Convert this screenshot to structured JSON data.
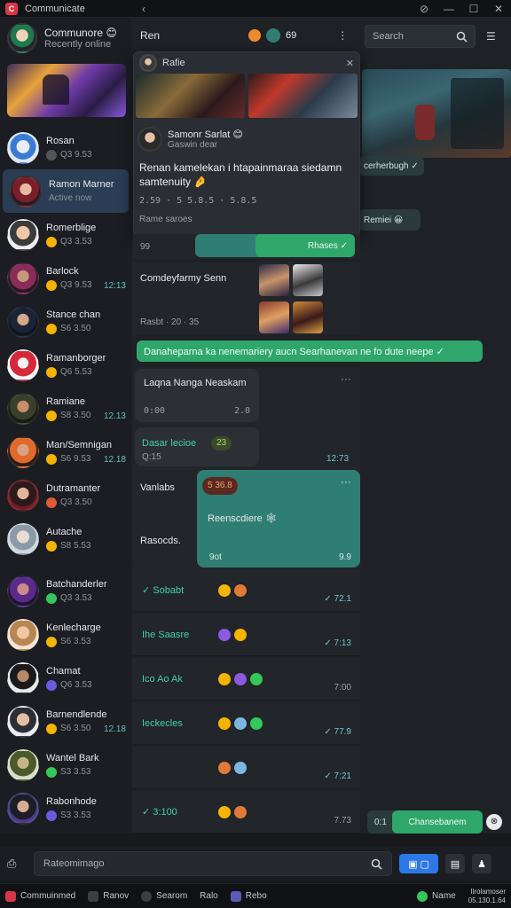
{
  "window": {
    "title": "Communicate",
    "logo": "C",
    "back_glyph": "‹",
    "controls": [
      "minimize",
      "maximize",
      "close"
    ]
  },
  "sidebar": {
    "profile": {
      "name": "Communore 😊",
      "status": "Recently online"
    },
    "contacts": [
      {
        "name": "Rosan",
        "line": "Q3 9.53",
        "time": ""
      },
      {
        "name": "Ramon Marner",
        "line": "Active now",
        "time": ""
      },
      {
        "name": "Romerblige",
        "line": "Q3 3.53",
        "time": ""
      },
      {
        "name": "Barlock",
        "line": "Q3 9.53",
        "time": "12:13"
      },
      {
        "name": "Stance chan",
        "line": "S6 3.50",
        "time": ""
      },
      {
        "name": "Ramanborger",
        "line": "Q6 5.53",
        "time": ""
      },
      {
        "name": "Ramiane",
        "line": "S8 3.50",
        "time": "12.13"
      },
      {
        "name": "Man/Semnigan",
        "line": "S6 9.53",
        "time": "12.18"
      },
      {
        "name": "Dutramanter",
        "line": "Q3 3.50",
        "time": ""
      },
      {
        "name": "Autache",
        "line": "S8 5.53",
        "time": ""
      },
      {
        "name": "Batchanderler",
        "line": "Q3 3.53",
        "time": ""
      },
      {
        "name": "Kenlecharge",
        "line": "S6 3.53",
        "time": ""
      },
      {
        "name": "Chamat",
        "line": "Q6 3.53",
        "time": ""
      },
      {
        "name": "Barnendlende",
        "line": "S6 3.50",
        "time": "12.18"
      },
      {
        "name": "Wantel Bark",
        "line": "S3 3.53",
        "time": ""
      },
      {
        "name": "Rabonhode",
        "line": "S3 3.53",
        "time": ""
      }
    ]
  },
  "chat": {
    "title": "Ren",
    "header_count": "69",
    "search_placeholder": "Search",
    "popup": {
      "title": "Rafie",
      "user_name": "Samonr Sarlat 😊",
      "user_status": "Gaswin dear",
      "text": "Renan kamelekan i htapainmaraa siedamn samtenuity 🤌",
      "stats": "2.59 · 5 5.8.5 · 5.8.5",
      "foot": "Rame saroes"
    },
    "side_tags": [
      {
        "text": "cerherbugh ✓"
      },
      {
        "text": "Remiei 😀"
      }
    ],
    "bubbles": {
      "b1_left": "99",
      "b1_green": "Rhases ✓",
      "gallery_title": "Comdeyfarmy Senn",
      "gallery_sub": "Rasbt · 20 · 35",
      "banner": "Danaheparna ka nenemariery aucn Searhanevan ne fo dute neepe ✓",
      "card1_title": "Laqna Nanga Neaskam",
      "card1_left": "0:00",
      "card1_right": "2.0",
      "card1_menu": "···",
      "card2_title": "Dasar lecioe",
      "card2_badge": "23",
      "card2_sub": "Q:15",
      "card2_time": "12:73",
      "card3_title": "Vanlabs",
      "card3_badge": "5 36.8",
      "card3_body": "Reenscdiere 🕸",
      "card3_foot_left": "Rasocds.",
      "card3_time_a": "9ot",
      "card3_time_b": "9.9",
      "card3_menu": "···"
    },
    "rows": [
      {
        "left": "✓  Sobabt",
        "time": "✓ 72.1"
      },
      {
        "left": "Ihe Saasre",
        "time": "✓ 7:13"
      },
      {
        "left": "Ico Ao Ak",
        "time": "7:00"
      },
      {
        "left": "Ieckecles",
        "time": "✓ 77.9"
      },
      {
        "left": "",
        "time": "✓ 7:21"
      },
      {
        "left": "✓  3:100",
        "time": "7.73"
      }
    ],
    "bottom_pill": "Chansebanem",
    "bottom_pill_prefix": "0:1"
  },
  "composer": {
    "placeholder": "Rateomimago"
  },
  "taskbar": {
    "items": [
      "Commuinmed",
      "Ranov",
      "Searom",
      "Ralo",
      "Rebo"
    ],
    "right_status": "Name",
    "clock_top": "Ilrolamoser",
    "clock_bottom": "05.130.1.64"
  },
  "colors": {
    "accent": "#2f7e74",
    "green": "#2fa76a",
    "blue": "#2d78e6",
    "sidebar_active": "#2a3d55"
  }
}
